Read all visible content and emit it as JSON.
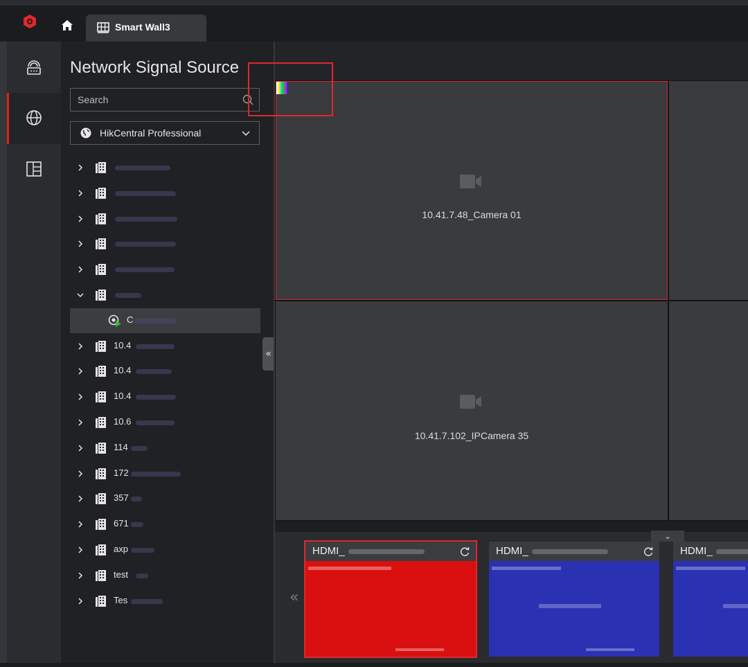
{
  "tab": {
    "label": "Smart Wall3"
  },
  "panel": {
    "title": "Network Signal Source",
    "search_placeholder": "Search",
    "site": "HikCentral Professional"
  },
  "tree": [
    {
      "prefix": "",
      "expanded": false
    },
    {
      "prefix": "",
      "expanded": false
    },
    {
      "prefix": "",
      "expanded": false
    },
    {
      "prefix": "",
      "expanded": false
    },
    {
      "prefix": "",
      "expanded": false
    },
    {
      "prefix": "",
      "expanded": true
    },
    {
      "prefix": "C",
      "child": true,
      "selected": true
    },
    {
      "prefix": "10.4",
      "expanded": false
    },
    {
      "prefix": "10.4",
      "expanded": false
    },
    {
      "prefix": "10.4",
      "expanded": false
    },
    {
      "prefix": "10.6",
      "expanded": false
    },
    {
      "prefix": "114",
      "expanded": false
    },
    {
      "prefix": "172",
      "expanded": false
    },
    {
      "prefix": "357",
      "expanded": false
    },
    {
      "prefix": "671",
      "expanded": false
    },
    {
      "prefix": "axp",
      "expanded": false
    },
    {
      "prefix": "test",
      "expanded": false
    },
    {
      "prefix": "Tes",
      "expanded": false
    }
  ],
  "wall": {
    "tiles": [
      {
        "label": "10.41.7.48_Camera 01"
      },
      {
        "label": "10.41.7.102_IPCamera 35"
      }
    ]
  },
  "outputs": [
    {
      "label": "HDMI_",
      "screen_color": "#d9100f",
      "selected": true
    },
    {
      "label": "HDMI_",
      "screen_color": "#2b31b3",
      "selected": false
    },
    {
      "label": "HDMI_",
      "screen_color": "#2b31b3",
      "selected": false
    }
  ],
  "colors": {
    "accent": "#e02020",
    "panel_bg": "#202124",
    "tile_bg": "#393b3e"
  },
  "icons": [
    "logo-icon",
    "home-icon",
    "video-wall-icon",
    "remote-signal-icon",
    "globe-icon",
    "layout-icon",
    "search-icon",
    "chevron-down-icon",
    "building-icon",
    "camera-online-icon",
    "refresh-icon"
  ]
}
